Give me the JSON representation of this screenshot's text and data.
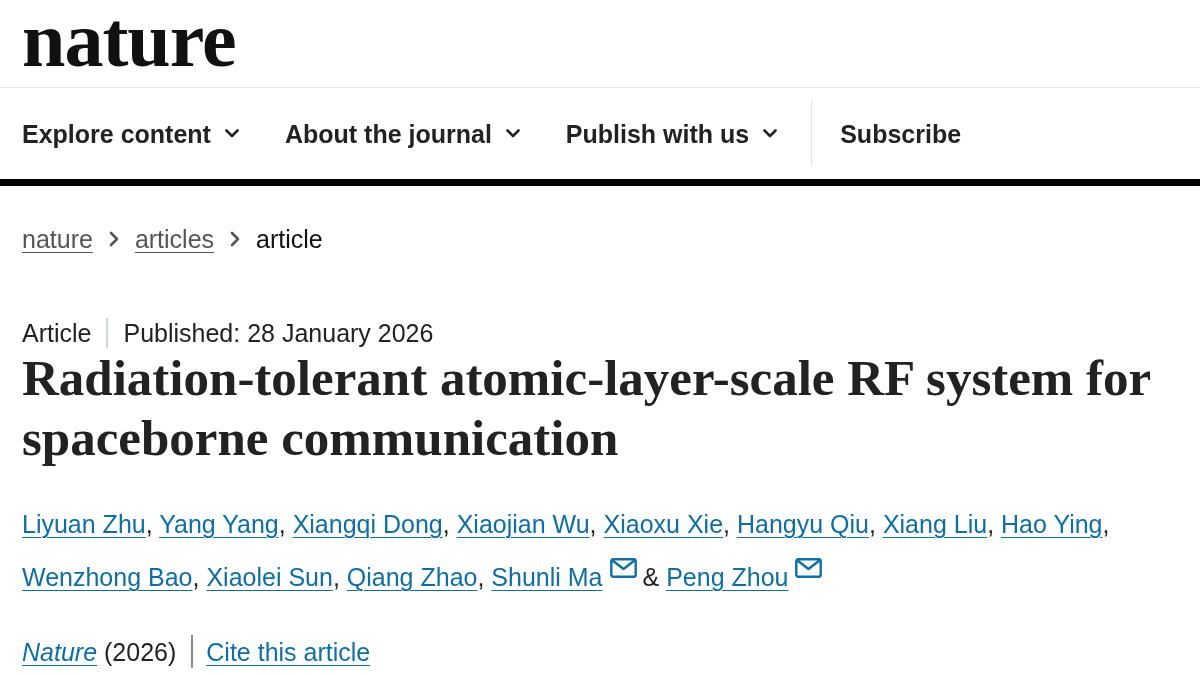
{
  "header": {
    "logo": "nature"
  },
  "nav": [
    {
      "label": "Explore content",
      "kind": "dropdown"
    },
    {
      "label": "About the journal",
      "kind": "dropdown"
    },
    {
      "label": "Publish with us",
      "kind": "dropdown"
    },
    {
      "label": "Subscribe",
      "kind": "link"
    }
  ],
  "breadcrumbs": [
    {
      "label": "nature",
      "link": true
    },
    {
      "label": "articles",
      "link": true
    },
    {
      "label": "article",
      "link": false
    }
  ],
  "article": {
    "type": "Article",
    "published": "Published: 28 January 2026",
    "title": "Radiation-tolerant atomic-layer-scale RF system for spaceborne communication",
    "authors": [
      {
        "name": "Liyuan Zhu",
        "email": false,
        "separator": ","
      },
      {
        "name": "Yang Yang",
        "email": false,
        "separator": ","
      },
      {
        "name": "Xiangqi Dong",
        "email": false,
        "separator": ","
      },
      {
        "name": "Xiaojian Wu",
        "email": false,
        "separator": ","
      },
      {
        "name": "Xiaoxu Xie",
        "email": false,
        "separator": ","
      },
      {
        "name": "Hangyu Qiu",
        "email": false,
        "separator": ","
      },
      {
        "name": "Xiang Liu",
        "email": false,
        "separator": ","
      },
      {
        "name": "Hao Ying",
        "email": false,
        "separator": ","
      },
      {
        "name": "Wenzhong Bao",
        "email": false,
        "separator": ","
      },
      {
        "name": "Xiaolei Sun",
        "email": false,
        "separator": ","
      },
      {
        "name": "Qiang Zhao",
        "email": false,
        "separator": ","
      },
      {
        "name": "Shunli Ma",
        "email": true,
        "separator": "&"
      },
      {
        "name": "Peng Zhou",
        "email": true
      }
    ],
    "citation": {
      "journal": "Nature",
      "year": "(2026)",
      "cite": "Cite this article"
    }
  }
}
